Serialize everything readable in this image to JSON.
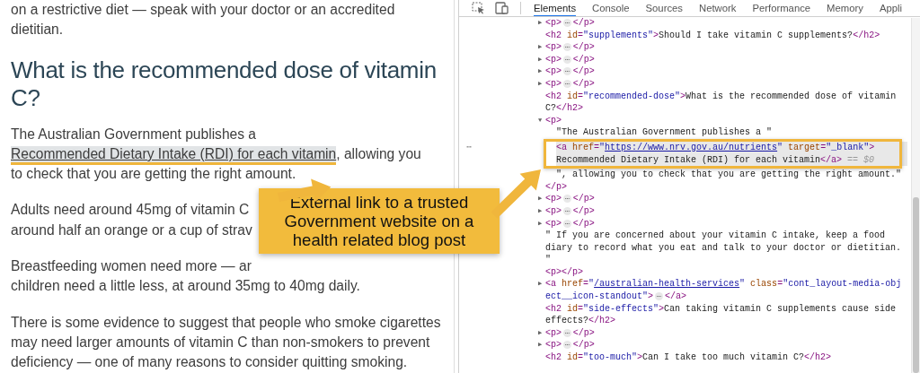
{
  "article": {
    "blocks": [
      {
        "kind": "paragraph",
        "lines": [
          "on a restrictive diet — speak with your doctor or an accredited",
          "dietitian."
        ]
      },
      {
        "kind": "heading",
        "text": "What is the recommended dose of vitamin C?"
      },
      {
        "kind": "link_paragraph",
        "before": "The Australian Government publishes a ",
        "link": "Recommended Dietary Intake (RDI) for each vitamin",
        "after": ", allowing you to check that you are getting the right amount."
      },
      {
        "kind": "paragraph",
        "lines": [
          "Adults need around 45mg of vitamin C",
          "around half an orange or a cup of strav"
        ]
      },
      {
        "kind": "paragraph",
        "lines": [
          "Breastfeeding women need more — ar",
          "children need a little less, at around 35mg to 40mg daily."
        ]
      },
      {
        "kind": "paragraph",
        "lines": [
          "There is some evidence to suggest that people who smoke cigarettes",
          "may need larger amounts of vitamin C than non-smokers to prevent",
          "deficiency — one of many reasons to consider quitting smoking."
        ]
      }
    ]
  },
  "devtools": {
    "tabs": [
      {
        "label": "Elements",
        "selected": true
      },
      {
        "label": "Console",
        "selected": false
      },
      {
        "label": "Sources",
        "selected": false
      },
      {
        "label": "Network",
        "selected": false
      },
      {
        "label": "Performance",
        "selected": false
      },
      {
        "label": "Memory",
        "selected": false
      },
      {
        "label": "Appli",
        "selected": false
      }
    ],
    "nodes": [
      {
        "toggle": "▶",
        "selected": false,
        "lines": [
          [
            {
              "kind": "tag",
              "text": "<p>"
            },
            {
              "kind": "ellipsis",
              "text": "⋯"
            },
            {
              "kind": "tag",
              "text": "</p>"
            }
          ]
        ]
      },
      {
        "selected": false,
        "lines": [
          [
            {
              "kind": "tag",
              "text": "<h2 "
            },
            {
              "kind": "attr",
              "text": "id"
            },
            {
              "kind": "tag",
              "text": "="
            },
            {
              "kind": "value",
              "text": "\"supplements\""
            },
            {
              "kind": "tag",
              "text": ">"
            },
            {
              "kind": "text",
              "text": "Should I take vitamin C supplements?"
            },
            {
              "kind": "tag",
              "text": "</h2>"
            }
          ]
        ]
      },
      {
        "toggle": "▶",
        "selected": false,
        "lines": [
          [
            {
              "kind": "tag",
              "text": "<p>"
            },
            {
              "kind": "ellipsis",
              "text": "⋯"
            },
            {
              "kind": "tag",
              "text": "</p>"
            }
          ]
        ]
      },
      {
        "toggle": "▶",
        "selected": false,
        "lines": [
          [
            {
              "kind": "tag",
              "text": "<p>"
            },
            {
              "kind": "ellipsis",
              "text": "⋯"
            },
            {
              "kind": "tag",
              "text": "</p>"
            }
          ]
        ]
      },
      {
        "toggle": "▶",
        "selected": false,
        "lines": [
          [
            {
              "kind": "tag",
              "text": "<p>"
            },
            {
              "kind": "ellipsis",
              "text": "⋯"
            },
            {
              "kind": "tag",
              "text": "</p>"
            }
          ]
        ]
      },
      {
        "toggle": "▶",
        "selected": false,
        "lines": [
          [
            {
              "kind": "tag",
              "text": "<p>"
            },
            {
              "kind": "ellipsis",
              "text": "⋯"
            },
            {
              "kind": "tag",
              "text": "</p>"
            }
          ]
        ]
      },
      {
        "selected": false,
        "lines": [
          [
            {
              "kind": "tag",
              "text": "<h2 "
            },
            {
              "kind": "attr",
              "text": "id"
            },
            {
              "kind": "tag",
              "text": "="
            },
            {
              "kind": "value",
              "text": "\"recommended-dose\""
            },
            {
              "kind": "tag",
              "text": ">"
            },
            {
              "kind": "text",
              "text": "What is the recommended dose of vitamin"
            }
          ],
          [
            {
              "kind": "text",
              "text": "C?"
            },
            {
              "kind": "tag",
              "text": "</h2>"
            }
          ]
        ]
      },
      {
        "toggle": "▼",
        "selected": false,
        "lines": [
          [
            {
              "kind": "tag",
              "text": "<p>"
            }
          ]
        ],
        "children": [
          {
            "selected": false,
            "lines": [
              [
                {
                  "kind": "text",
                  "text": "\"The Australian Government publishes a \""
                }
              ]
            ]
          },
          {
            "selected": true,
            "row_menu": "⋯",
            "lines": [
              [
                {
                  "kind": "tag",
                  "text": "<a "
                },
                {
                  "kind": "attr",
                  "text": "href"
                },
                {
                  "kind": "tag",
                  "text": "="
                },
                {
                  "kind": "value",
                  "text": "\""
                },
                {
                  "kind": "link",
                  "text": "https://www.nrv.gov.au/nutrients"
                },
                {
                  "kind": "value",
                  "text": "\" "
                },
                {
                  "kind": "attr",
                  "text": "target"
                },
                {
                  "kind": "tag",
                  "text": "="
                },
                {
                  "kind": "value",
                  "text": "\"_blank\""
                },
                {
                  "kind": "tag",
                  "text": ">"
                }
              ],
              [
                {
                  "kind": "text",
                  "text": "Recommended Dietary Intake (RDI) for each vitamin"
                },
                {
                  "kind": "tag",
                  "text": "</a>"
                },
                {
                  "kind": "note",
                  "text": " == $0"
                }
              ]
            ]
          },
          {
            "selected": false,
            "lines": [
              [
                {
                  "kind": "text",
                  "text": "\", allowing you to check that you are getting the right amount.\""
                }
              ]
            ]
          }
        ],
        "close": [
          {
            "kind": "tag",
            "text": "</p>"
          }
        ]
      },
      {
        "toggle": "▶",
        "selected": false,
        "lines": [
          [
            {
              "kind": "tag",
              "text": "<p>"
            },
            {
              "kind": "ellipsis",
              "text": "⋯"
            },
            {
              "kind": "tag",
              "text": "</p>"
            }
          ]
        ]
      },
      {
        "toggle": "▶",
        "selected": false,
        "lines": [
          [
            {
              "kind": "tag",
              "text": "<p>"
            },
            {
              "kind": "ellipsis",
              "text": "⋯"
            },
            {
              "kind": "tag",
              "text": "</p>"
            }
          ]
        ]
      },
      {
        "toggle": "▶",
        "selected": false,
        "lines": [
          [
            {
              "kind": "tag",
              "text": "<p>"
            },
            {
              "kind": "ellipsis",
              "text": "⋯"
            },
            {
              "kind": "tag",
              "text": "</p>"
            }
          ]
        ]
      },
      {
        "selected": false,
        "lines": [
          [
            {
              "kind": "text",
              "text": "\" If you are concerned about your vitamin C intake, keep a food"
            }
          ],
          [
            {
              "kind": "text",
              "text": "diary to record what you eat and talk to your doctor or dietitian."
            }
          ],
          [
            {
              "kind": "text",
              "text": "\""
            }
          ]
        ]
      },
      {
        "selected": false,
        "lines": [
          [
            {
              "kind": "tag",
              "text": "<p></p>"
            }
          ]
        ]
      },
      {
        "toggle": "▶",
        "selected": false,
        "lines": [
          [
            {
              "kind": "tag",
              "text": "<a "
            },
            {
              "kind": "attr",
              "text": "href"
            },
            {
              "kind": "tag",
              "text": "="
            },
            {
              "kind": "value",
              "text": "\""
            },
            {
              "kind": "link",
              "text": "/australian-health-services"
            },
            {
              "kind": "value",
              "text": "\" "
            },
            {
              "kind": "attr",
              "text": "class"
            },
            {
              "kind": "tag",
              "text": "="
            },
            {
              "kind": "value",
              "text": "\"cont_layout-media-obj"
            }
          ],
          [
            {
              "kind": "value",
              "text": "ect__icon-standout\""
            },
            {
              "kind": "tag",
              "text": ">"
            },
            {
              "kind": "ellipsis",
              "text": "⋯"
            },
            {
              "kind": "tag",
              "text": "</a>"
            }
          ]
        ]
      },
      {
        "selected": false,
        "lines": [
          [
            {
              "kind": "tag",
              "text": "<h2 "
            },
            {
              "kind": "attr",
              "text": "id"
            },
            {
              "kind": "tag",
              "text": "="
            },
            {
              "kind": "value",
              "text": "\"side-effects\""
            },
            {
              "kind": "tag",
              "text": ">"
            },
            {
              "kind": "text",
              "text": "Can taking vitamin C supplements cause side"
            }
          ],
          [
            {
              "kind": "text",
              "text": "effects?"
            },
            {
              "kind": "tag",
              "text": "</h2>"
            }
          ]
        ]
      },
      {
        "toggle": "▶",
        "selected": false,
        "lines": [
          [
            {
              "kind": "tag",
              "text": "<p>"
            },
            {
              "kind": "ellipsis",
              "text": "⋯"
            },
            {
              "kind": "tag",
              "text": "</p>"
            }
          ]
        ]
      },
      {
        "toggle": "▶",
        "selected": false,
        "lines": [
          [
            {
              "kind": "tag",
              "text": "<p>"
            },
            {
              "kind": "ellipsis",
              "text": "⋯"
            },
            {
              "kind": "tag",
              "text": "</p>"
            }
          ]
        ]
      },
      {
        "selected": false,
        "lines": [
          [
            {
              "kind": "tag",
              "text": "<h2 "
            },
            {
              "kind": "attr",
              "text": "id"
            },
            {
              "kind": "tag",
              "text": "="
            },
            {
              "kind": "value",
              "text": "\"too-much\""
            },
            {
              "kind": "tag",
              "text": ">"
            },
            {
              "kind": "text",
              "text": "Can I take too much vitamin C?"
            },
            {
              "kind": "tag",
              "text": "</h2>"
            }
          ]
        ]
      }
    ]
  },
  "callout": {
    "text": "External link to a trusted Government website on a health related blog post"
  }
}
